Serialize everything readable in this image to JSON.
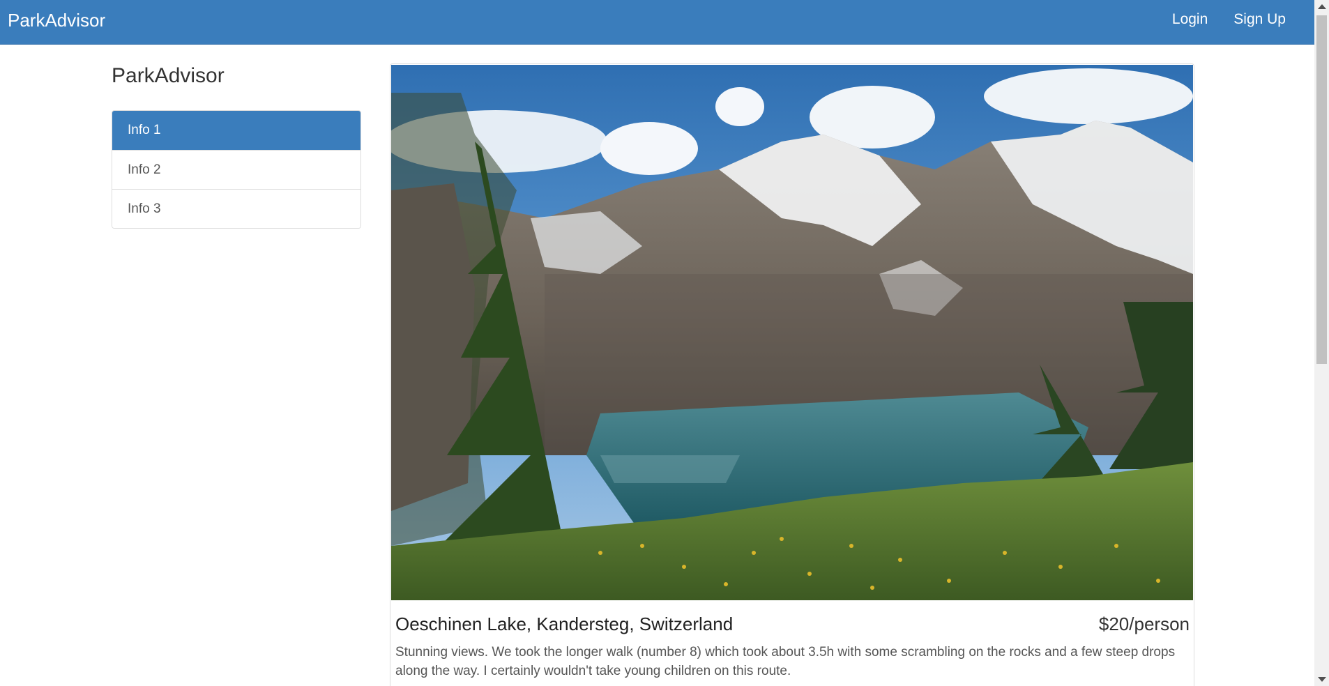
{
  "navbar": {
    "brand": "ParkAdvisor",
    "links": [
      "Login",
      "Sign Up"
    ]
  },
  "sidebar": {
    "title": "ParkAdvisor",
    "items": [
      {
        "label": "Info 1",
        "active": true
      },
      {
        "label": "Info 2",
        "active": false
      },
      {
        "label": "Info 3",
        "active": false
      }
    ]
  },
  "park": {
    "image_subject": "alpine lake with snowy mountains, pine trees and grassy meadow",
    "title": "Oeschinen Lake, Kandersteg, Switzerland",
    "price": "$20/person",
    "description": "Stunning views. We took the longer walk (number 8) which took about 3.5h with some scrambling on the rocks and a few steep drops along the way. I certainly wouldn't take young children on this route."
  },
  "colors": {
    "primary": "#3a7dbc",
    "text": "#333333",
    "muted_text": "#555555",
    "border": "#dddddd"
  },
  "icons": {
    "scroll_up": "triangle-up-icon",
    "scroll_down": "triangle-down-icon"
  }
}
